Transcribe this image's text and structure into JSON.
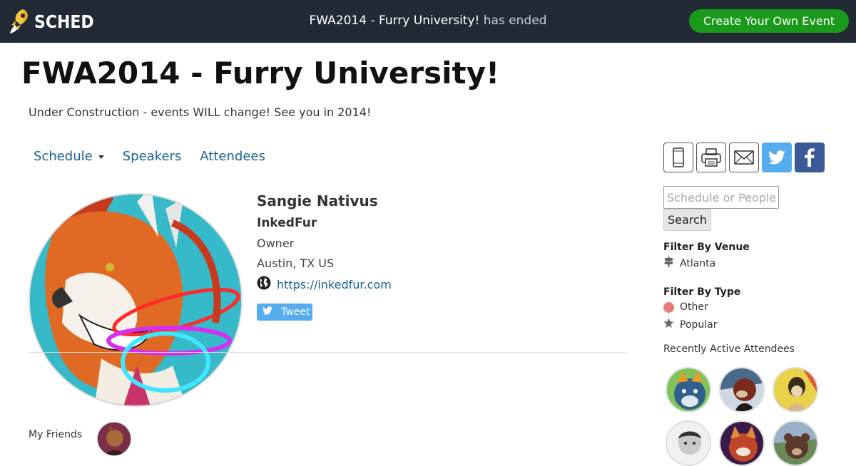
{
  "header": {
    "logo_text": "SCHED",
    "event_name": "FWA2014 - Furry University!",
    "event_status": "has ended",
    "create_button": "Create Your Own Event"
  },
  "page": {
    "title": "FWA2014 - Furry University!",
    "tagline": "Under Construction - events WILL change! See you in 2014!"
  },
  "nav": {
    "items": [
      {
        "label": "Schedule",
        "has_dropdown": true
      },
      {
        "label": "Speakers"
      },
      {
        "label": "Attendees"
      }
    ]
  },
  "profile": {
    "name": "Sangie Nativus",
    "company": "InkedFur",
    "role": "Owner",
    "location": "Austin, TX US",
    "url": "https://inkedfur.com",
    "tweet_label": "Tweet"
  },
  "friends": {
    "label": "My Friends"
  },
  "sidebar": {
    "share_icons": [
      "mobile-icon",
      "print-icon",
      "email-icon",
      "twitter-icon",
      "facebook-icon"
    ],
    "search": {
      "placeholder": "Schedule or People",
      "button": "Search"
    },
    "filter_venue": {
      "title": "Filter By Venue",
      "items": [
        "Atlanta"
      ]
    },
    "filter_type": {
      "title": "Filter By Type",
      "items": [
        "Other",
        "Popular"
      ]
    },
    "recent_title": "Recently Active Attendees"
  },
  "colors": {
    "topbar": "#222b35",
    "create_button": "#1a9a1a",
    "link": "#1a6196",
    "twitter": "#55acee",
    "facebook": "#3b5998",
    "type_other": "#e77b7b"
  }
}
